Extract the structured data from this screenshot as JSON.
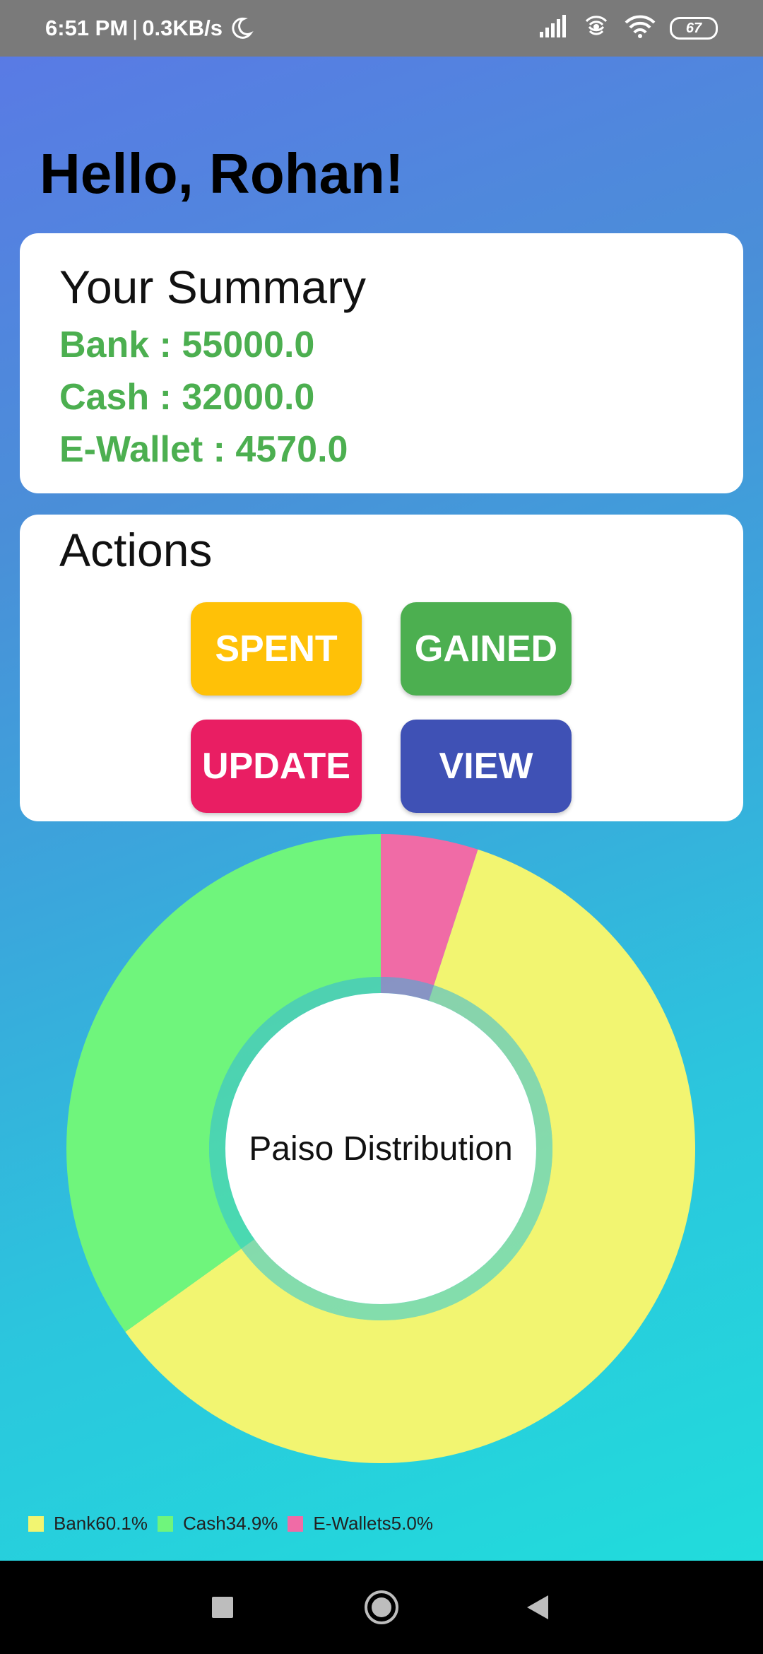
{
  "status_bar": {
    "time": "6:51 PM",
    "separator": "|",
    "net_speed": "0.3KB/s",
    "battery": "67",
    "icons": [
      "moon-icon",
      "signal-icon",
      "hotspot-icon",
      "wifi-icon",
      "battery-icon"
    ]
  },
  "greeting": "Hello, Rohan!",
  "summary": {
    "title": "Your Summary",
    "lines": [
      "Bank : 55000.0",
      "Cash : 32000.0",
      "E-Wallet : 4570.0"
    ],
    "value_color": "#4caf50"
  },
  "actions": {
    "title": "Actions",
    "buttons": [
      {
        "label": "SPENT",
        "color": "#ffc107"
      },
      {
        "label": "GAINED",
        "color": "#4caf50"
      },
      {
        "label": "UPDATE",
        "color": "#e91e63"
      },
      {
        "label": "VIEW",
        "color": "#3f51b5"
      }
    ]
  },
  "chart_data": {
    "type": "pie",
    "title": "Paiso Distribution",
    "categories": [
      "Bank",
      "Cash",
      "E-Wallets"
    ],
    "values": [
      60.1,
      34.9,
      5.0
    ],
    "colors": [
      "#f2f571",
      "#6ff57c",
      "#f06ba6"
    ],
    "legend": [
      "Bank60.1%",
      "Cash34.9%",
      "E-Wallets5.0%"
    ],
    "legend_position": "bottom-left"
  },
  "nav_bar": {
    "icons": [
      "recents-square-icon",
      "home-circle-icon",
      "back-triangle-icon"
    ]
  }
}
